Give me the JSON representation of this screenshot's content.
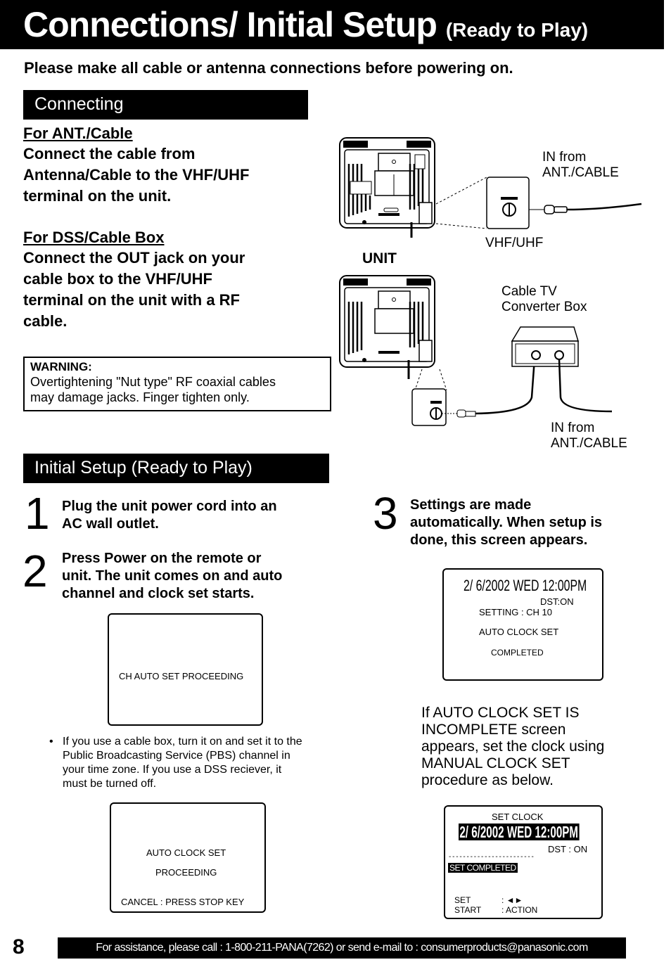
{
  "header": {
    "title": "Connections/ Initial Setup",
    "subtitle": "(Ready to Play)"
  },
  "intro": "Please make all cable or antenna connections before powering on.",
  "connecting": {
    "heading": "Connecting",
    "ant_cable": {
      "title": "For ANT./Cable",
      "lines": [
        "Connect the cable from",
        "Antenna/Cable to the VHF/UHF",
        "terminal on the unit."
      ]
    },
    "dss_cable_box": {
      "title": "For DSS/Cable Box",
      "lines": [
        "Connect the OUT jack on your",
        "cable box to the VHF/UHF",
        "terminal on the unit with a RF",
        "cable."
      ]
    },
    "warning": {
      "title": "WARNING:",
      "lines": [
        "Overtightening \"Nut type\" RF coaxial cables",
        "may damage jacks. Finger tighten only."
      ]
    },
    "diagram1": {
      "in_from_1": "IN from",
      "in_from_2": "ANT./CABLE",
      "vhf_uhf": "VHF/UHF",
      "unit": "UNIT"
    },
    "diagram2": {
      "box_1": "Cable TV",
      "box_2": "Converter Box",
      "in_from_1": "IN from",
      "in_from_2": "ANT./CABLE"
    }
  },
  "initial_setup": {
    "heading": "Initial Setup (Ready to Play)",
    "steps": [
      {
        "num": "1",
        "lines": [
          "Plug the unit power cord into an",
          "AC wall outlet."
        ]
      },
      {
        "num": "2",
        "lines": [
          "Press Power on the remote or",
          "unit. The unit comes on and auto",
          "channel and clock set starts."
        ]
      },
      {
        "num": "3",
        "lines": [
          "Settings are made",
          "automatically. When setup is",
          "done, this screen appears."
        ]
      }
    ],
    "screen_ch_auto": "CH AUTO SET PROCEEDING",
    "bullet_note": {
      "symbol": "•",
      "lines": [
        "If you use a cable box, turn it on and set it to the",
        "Public Broadcasting Service (PBS) channel in",
        "your time zone. If you use a DSS reciever, it",
        "must be turned off."
      ]
    },
    "screen_auto_clock": {
      "line1": "AUTO CLOCK SET",
      "line2": "PROCEEDING",
      "cancel": "CANCEL : PRESS STOP KEY"
    },
    "screen_completed": {
      "datetime": "2/ 6/2002 WED 12:00PM",
      "dst": "DST:ON",
      "setting": "SETTING : CH 10",
      "auto_clock": "AUTO CLOCK SET",
      "completed": "COMPLETED"
    },
    "incomplete_note": {
      "lines": [
        "If AUTO CLOCK SET IS",
        "INCOMPLETE screen",
        "appears, set the clock using",
        "MANUAL CLOCK SET",
        "procedure as below."
      ]
    },
    "screen_set_clock": {
      "title": "SET CLOCK",
      "datetime": "2/  6/2002 WED  12:00PM",
      "dst": "DST : ON",
      "divider": "- - - - - - - - - - - - - - - - - - - - - - - -",
      "set_completed": "SET COMPLETED",
      "set_label": "SET",
      "set_value": ": ◄►",
      "start_label": "START",
      "start_value": ": ACTION"
    }
  },
  "footer": {
    "page_number": "8",
    "assistance": "For assistance, please call : 1-800-211-PANA(7262) or send e-mail to : consumerproducts@panasonic.com"
  }
}
